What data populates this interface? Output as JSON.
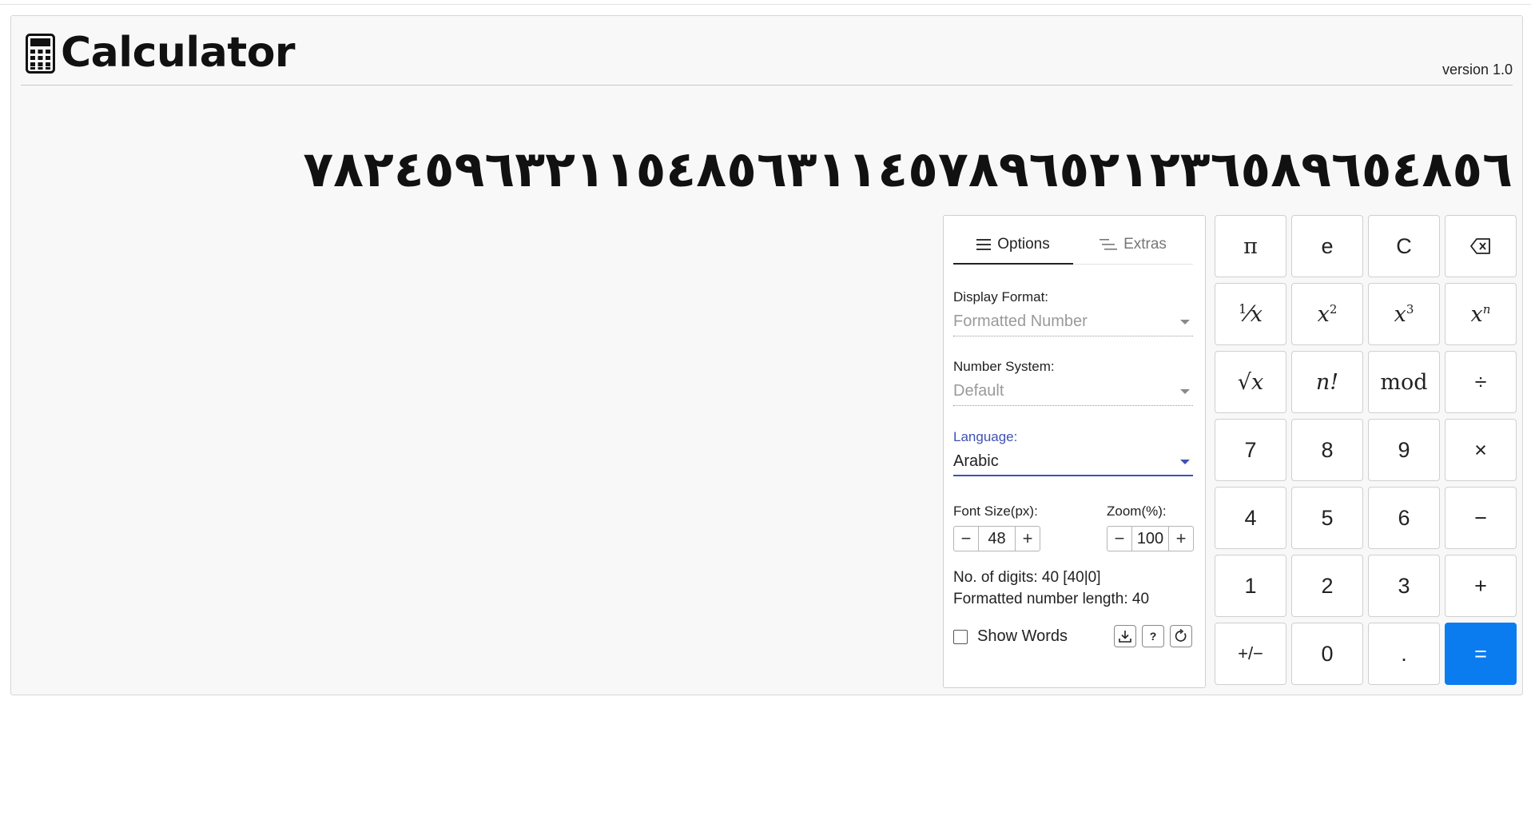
{
  "app": {
    "title": "Calculator",
    "version": "version 1.0"
  },
  "display": {
    "value": "٧٨٢٤٥٩٦٣٢١١٥٤٨٥٦٣١١٤٥٧٨٩٦٥٢١٢٣٦٥٨٩٦٥٤٨٥٦"
  },
  "options": {
    "tabs": [
      {
        "label": "Options",
        "icon": "menu-icon",
        "active": true
      },
      {
        "label": "Extras",
        "icon": "sort-lines-icon",
        "active": false
      }
    ],
    "display_format": {
      "label": "Display Format:",
      "value": "Formatted Number"
    },
    "number_system": {
      "label": "Number System:",
      "value": "Default"
    },
    "language": {
      "label": "Language:",
      "value": "Arabic"
    },
    "font_size": {
      "label": "Font Size(px):",
      "value": "48",
      "minus": "−",
      "plus": "+"
    },
    "zoom": {
      "label": "Zoom(%):",
      "value": "100",
      "minus": "−",
      "plus": "+"
    },
    "digits_info": "No. of digits: 40 [40|0]",
    "length_info": "Formatted number length: 40",
    "show_words": {
      "label": "Show Words",
      "checked": false
    },
    "help_label": "?",
    "accent_color": "#3f51b5"
  },
  "keypad": {
    "rows": [
      [
        "π",
        "e",
        "C",
        "backspace"
      ],
      [
        "1/x",
        "x2",
        "x3",
        "xn"
      ],
      [
        "√x",
        "n!",
        "mod",
        "÷"
      ],
      [
        "7",
        "8",
        "9",
        "×"
      ],
      [
        "4",
        "5",
        "6",
        "−"
      ],
      [
        "1",
        "2",
        "3",
        "+"
      ],
      [
        "+/−",
        "0",
        ".",
        "="
      ]
    ],
    "equals_color": "#0a7cf0"
  }
}
